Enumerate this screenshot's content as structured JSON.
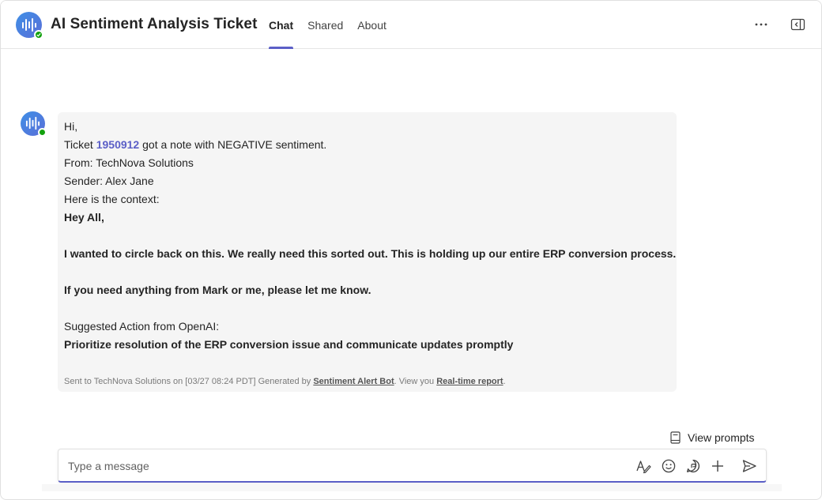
{
  "header": {
    "title": "AI Sentiment Analysis Ticket",
    "tabs": [
      {
        "label": "Chat",
        "active": true
      },
      {
        "label": "Shared",
        "active": false
      },
      {
        "label": "About",
        "active": false
      }
    ],
    "icons": [
      "more-options-icon",
      "open-side-panel-icon"
    ]
  },
  "message": {
    "greeting": "Hi,",
    "ticket_prefix": "Ticket ",
    "ticket_id": "1950912",
    "ticket_suffix": " got a note with NEGATIVE sentiment.",
    "from": "From: TechNova Solutions",
    "sender": "Sender: Alex Jane",
    "context_label": "Here is the context:",
    "context_greeting": "Hey All,",
    "context_body": "I wanted to circle back on this. We really need this sorted out. This is holding up our entire ERP conversion process.",
    "context_closing": "If you need anything from Mark or me, please let me know.",
    "suggested_label": "Suggested Action from OpenAI:",
    "suggested_action": "Prioritize resolution of the ERP conversion issue and communicate updates promptly",
    "footer_prefix": "Sent to TechNova Solutions on [03/27 08:24 PDT] Generated by ",
    "footer_bot_link": "Sentiment Alert Bot",
    "footer_middle": ". View you ",
    "footer_report_link": "Real-time report",
    "footer_end": "."
  },
  "compose": {
    "view_prompts_label": "View prompts",
    "placeholder": "Type a message",
    "icons": [
      "format-icon",
      "emoji-icon",
      "loop-icon",
      "attach-plus-icon",
      "send-icon"
    ]
  },
  "colors": {
    "accent": "#5b5fc7",
    "presence": "#13a10e",
    "bubble_bg": "#f5f5f5"
  }
}
